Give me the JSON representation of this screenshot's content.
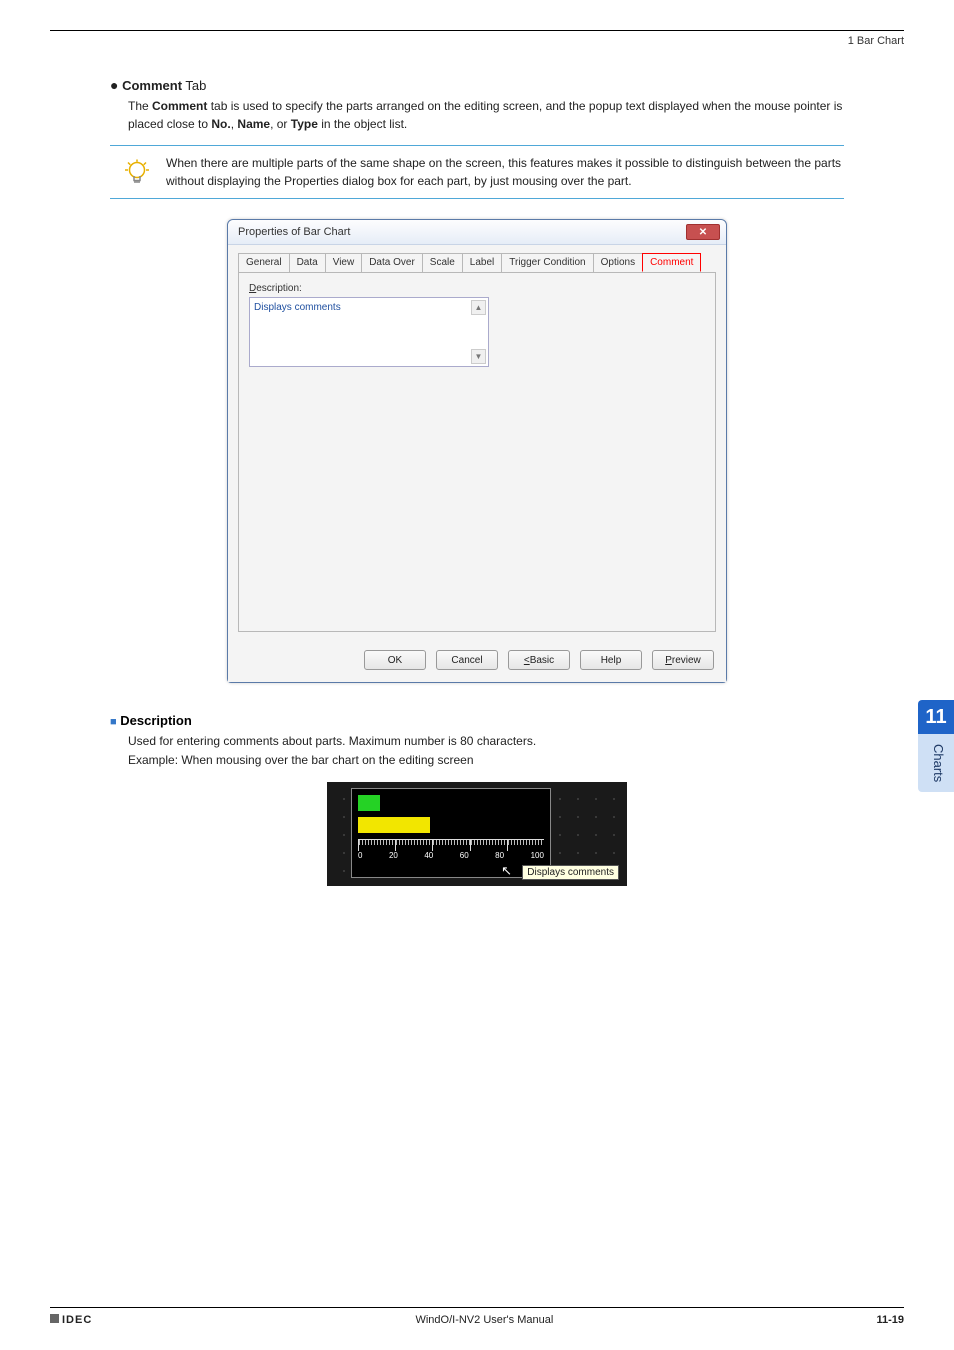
{
  "header": {
    "right": "1 Bar Chart"
  },
  "section": {
    "bullet": "●",
    "title_strong": "Comment",
    "title_suffix": " Tab",
    "intro_a": "The ",
    "intro_b": "Comment",
    "intro_c": " tab is used to specify the parts arranged on the editing screen, and the popup text displayed when the mouse pointer is placed close to ",
    "intro_d": "No.",
    "intro_e": ", ",
    "intro_f": "Name",
    "intro_g": ", or ",
    "intro_h": "Type",
    "intro_i": " in the object list."
  },
  "tip": {
    "text": "When there are multiple parts of the same shape on the screen, this features makes it possible to distinguish between the parts without displaying the Properties dialog box for each part, by just mousing over the part."
  },
  "dialog": {
    "title": "Properties of Bar Chart",
    "tabs": {
      "general": "General",
      "data": "Data",
      "view": "View",
      "dataover": "Data Over",
      "scale": "Scale",
      "label": "Label",
      "trigger": "Trigger Condition",
      "options": "Options",
      "comment": "Comment"
    },
    "desc_label_u": "D",
    "desc_label_rest": "escription:",
    "desc_value": "Displays comments",
    "buttons": {
      "ok": "OK",
      "cancel": "Cancel",
      "basic_u": "<",
      "basic_rest": " Basic",
      "help": "Help",
      "preview_u": "P",
      "preview_rest": "review"
    }
  },
  "description": {
    "square": "■",
    "heading": "Description",
    "line1": "Used for entering comments about parts. Maximum number is 80 characters.",
    "line2": "Example: When mousing over the bar chart on the editing screen"
  },
  "example": {
    "ticks": {
      "t0": "0",
      "t1": "20",
      "t2": "40",
      "t3": "60",
      "t4": "80",
      "t5": "100"
    },
    "tooltip": "Displays comments"
  },
  "chart_data": {
    "type": "bar",
    "orientation": "horizontal",
    "xlim": [
      0,
      100
    ],
    "tick_values": [
      0,
      20,
      40,
      60,
      80,
      100
    ],
    "series": [
      {
        "name": "green",
        "value": 10,
        "color": "#25d225"
      },
      {
        "name": "yellow",
        "value": 40,
        "color": "#f2e600"
      }
    ]
  },
  "side": {
    "num": "11",
    "label": "Charts"
  },
  "footer": {
    "brand": "IDEC",
    "mid": "WindO/I-NV2 User's Manual",
    "page": "11-19"
  }
}
